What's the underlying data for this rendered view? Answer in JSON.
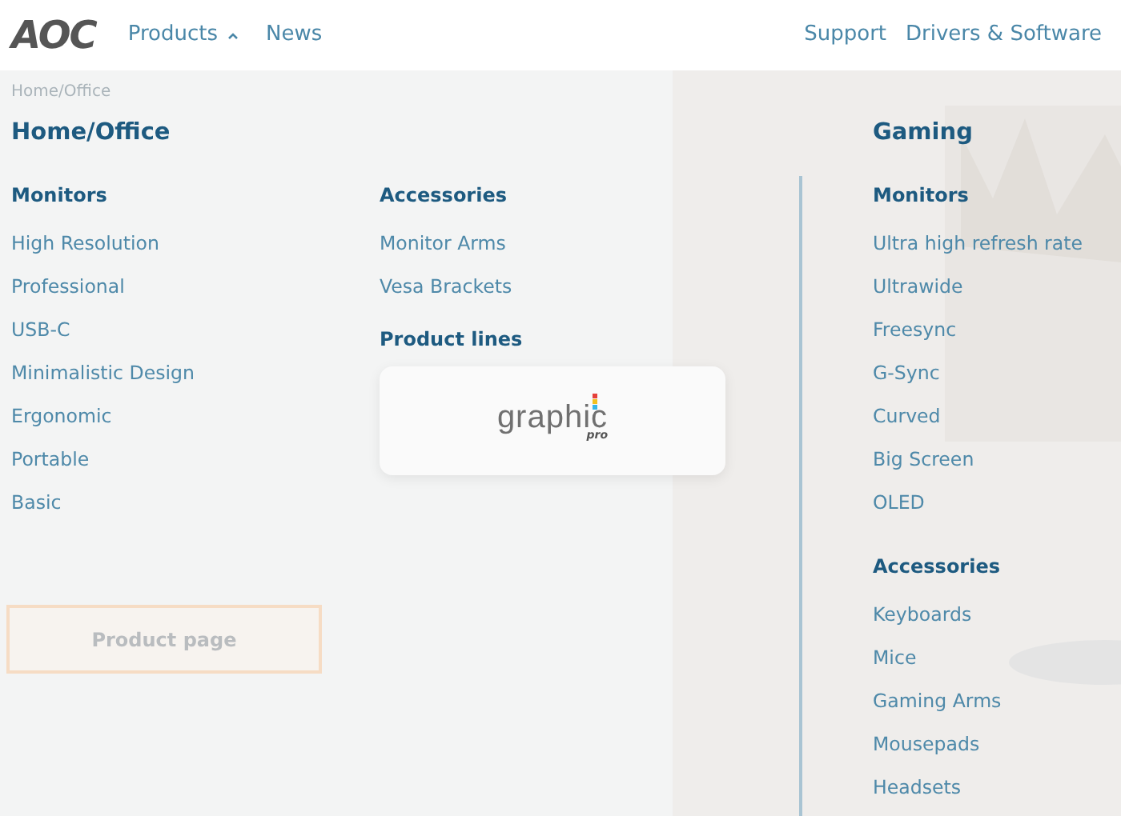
{
  "header": {
    "logo": "AOC",
    "nav": [
      {
        "label": "Products",
        "expanded": true
      },
      {
        "label": "News",
        "expanded": false
      }
    ],
    "right_links": [
      "Support",
      "Drivers & Software"
    ]
  },
  "breadcrumb": "Home/Office",
  "background_button": "Product page",
  "menu": {
    "left": {
      "title": "Home/Office",
      "columns": [
        {
          "heading": "Monitors",
          "items": [
            "High Resolution",
            "Professional",
            "USB-C",
            "Minimalistic Design",
            "Ergonomic",
            "Portable",
            "Basic"
          ]
        },
        {
          "heading": "Accessories",
          "items": [
            "Monitor Arms",
            "Vesa Brackets"
          ],
          "product_lines": {
            "heading": "Product lines",
            "logo": {
              "word": "graphic",
              "sub": "pro"
            }
          }
        }
      ]
    },
    "right": {
      "title": "Gaming",
      "sections": [
        {
          "heading": "Monitors",
          "items": [
            "Ultra high refresh rate",
            "Ultrawide",
            "Freesync",
            "G-Sync",
            "Curved",
            "Big Screen",
            "OLED"
          ]
        },
        {
          "heading": "Accessories",
          "items": [
            "Keyboards",
            "Mice",
            "Gaming Arms",
            "Mousepads",
            "Headsets"
          ]
        }
      ]
    }
  }
}
